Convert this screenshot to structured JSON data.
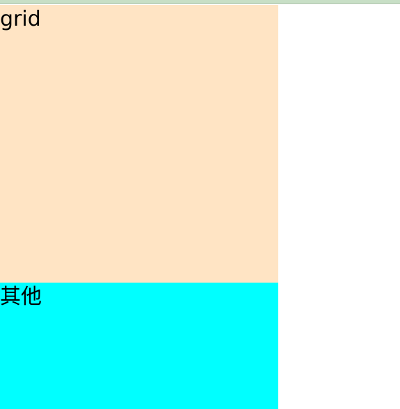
{
  "blocks": {
    "grid": {
      "label": "grid",
      "color": "#ffe4c4"
    },
    "other": {
      "label": "其他",
      "color": "#00ffff"
    }
  },
  "colors": {
    "top_strip": "#c8dfc6",
    "page_background": "#ffffff"
  }
}
